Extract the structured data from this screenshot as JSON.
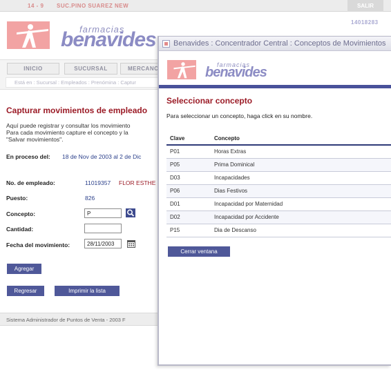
{
  "topbar": {
    "code": "14 - 9",
    "branch": "SUC.PINO SUAREZ NEW",
    "exit_label": "SALIR"
  },
  "page_id": "14018283",
  "logo": {
    "small": "farmacias",
    "big": "benavides"
  },
  "nav": {
    "tabs": [
      {
        "label": "INICIO"
      },
      {
        "label": "SUCURSAL"
      },
      {
        "label": "MERCANC"
      }
    ],
    "breadcrumb": "Está en : Sucursal : Empleados : Prenómina : Captur"
  },
  "page": {
    "title": "Capturar movimientos de empleado",
    "intro": [
      "Aquí puede registrar y consultar los movimiento",
      "Para cada movimiento capture el concepto y la",
      "\"Salvar movimientos\"."
    ],
    "period_label": "En proceso del:",
    "period_value": "18 de Nov de 2003 al 2 de Dic",
    "employee_label": "No. de empleado:",
    "employee_number": "11019357",
    "employee_name": "FLOR ESTHE",
    "position_label": "Puesto:",
    "position_value": "826",
    "concept_label": "Concepto:",
    "concept_value": "P",
    "quantity_label": "Cantidad:",
    "quantity_value": "",
    "date_label": "Fecha del movimiento:",
    "date_value": "28/11/2003",
    "add_button": "Agregar",
    "back_button": "Regresar",
    "print_button": "Imprimir la lista"
  },
  "footer": {
    "text": "Sistema Administrador de Puntos de Venta - 2003 F"
  },
  "popup": {
    "title": "Benavides : Concentrador Central : Conceptos de Movimientos",
    "heading": "Seleccionar concepto",
    "instructions": "Para seleccionar un concepto, haga click en su nombre.",
    "columns": {
      "code": "Clave",
      "concept": "Concepto"
    },
    "rows": [
      {
        "code": "P01",
        "concept": "Horas Extras"
      },
      {
        "code": "P05",
        "concept": "Prima Dominical"
      },
      {
        "code": "D03",
        "concept": "Incapacidades"
      },
      {
        "code": "P06",
        "concept": "Dias Festivos"
      },
      {
        "code": "D01",
        "concept": "Incapacidad por Maternidad"
      },
      {
        "code": "D02",
        "concept": "Incapacidad por Accidente"
      },
      {
        "code": "P15",
        "concept": "Dia de Descanso"
      }
    ],
    "close_button": "Cerrar ventana"
  },
  "colors": {
    "accent": "#4f5899",
    "title_red": "#9b1b26",
    "logo_pink": "#f2a3a3",
    "logo_blue": "#8c8cc4",
    "link_blue": "#2a3f8a"
  },
  "icons": {
    "search": "search-icon",
    "calendar": "calendar-icon"
  }
}
